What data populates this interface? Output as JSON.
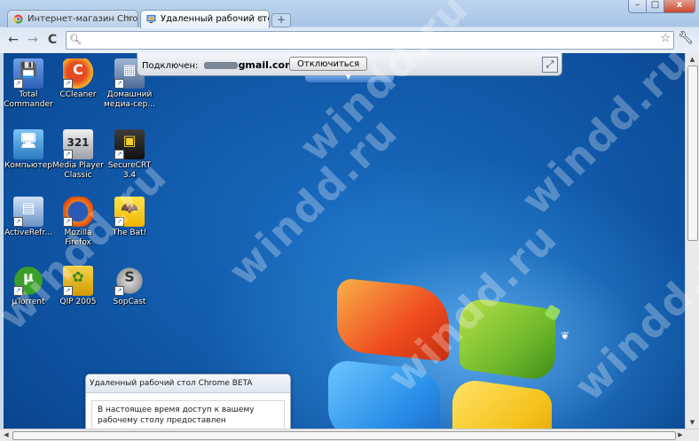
{
  "browser": {
    "tabs": [
      {
        "label": "Интернет-магазин Chrome",
        "active": false
      },
      {
        "label": "Удаленный рабочий стол",
        "active": true
      }
    ],
    "newtab_label": "+",
    "window_controls": {
      "minimize": "–",
      "maximize": "□",
      "close": "x"
    },
    "nav": {
      "back": "←",
      "forward": "→",
      "reload": "C"
    },
    "omnibox": {
      "value": "",
      "placeholder": ""
    }
  },
  "remote_session": {
    "connected_label": "Подключен:",
    "email_domain": "gmail.com",
    "disconnect_label": "Отключиться"
  },
  "desktop_icons": [
    {
      "label": "Total Commander",
      "icon": "total-commander-icon",
      "glyph": "💾"
    },
    {
      "label": "CCleaner",
      "icon": "ccleaner-icon",
      "glyph": "C"
    },
    {
      "label": "Домашний медиа-сер...",
      "icon": "home-media-server-icon",
      "glyph": "▦"
    },
    {
      "label": "Компьютер",
      "icon": "computer-icon",
      "glyph": "🖥"
    },
    {
      "label": "Media Player Classic",
      "icon": "media-player-classic-icon",
      "glyph": "321"
    },
    {
      "label": "SecureCRT 3.4",
      "icon": "securecrt-icon",
      "glyph": "▣"
    },
    {
      "label": "ActiveRefr...",
      "icon": "activerefresh-icon",
      "glyph": "▤"
    },
    {
      "label": "Mozilla Firefox",
      "icon": "firefox-icon",
      "glyph": ""
    },
    {
      "label": "The Bat!",
      "icon": "the-bat-icon",
      "glyph": "🦇"
    },
    {
      "label": "µTorrent",
      "icon": "utorrent-icon",
      "glyph": "µ"
    },
    {
      "label": "QIP 2005",
      "icon": "qip-icon",
      "glyph": "✿"
    },
    {
      "label": "SopCast",
      "icon": "sopcast-icon",
      "glyph": "S"
    }
  ],
  "notice": {
    "title": "Удаленный рабочий стол Chrome BETA",
    "text": "В настоящее время доступ к вашему рабочему столу предоставлен пользователю"
  },
  "watermark": "windd.ru",
  "colors": {
    "desktop_blue": "#0c4e9c",
    "chrome_frame": "#a9c5e6"
  }
}
